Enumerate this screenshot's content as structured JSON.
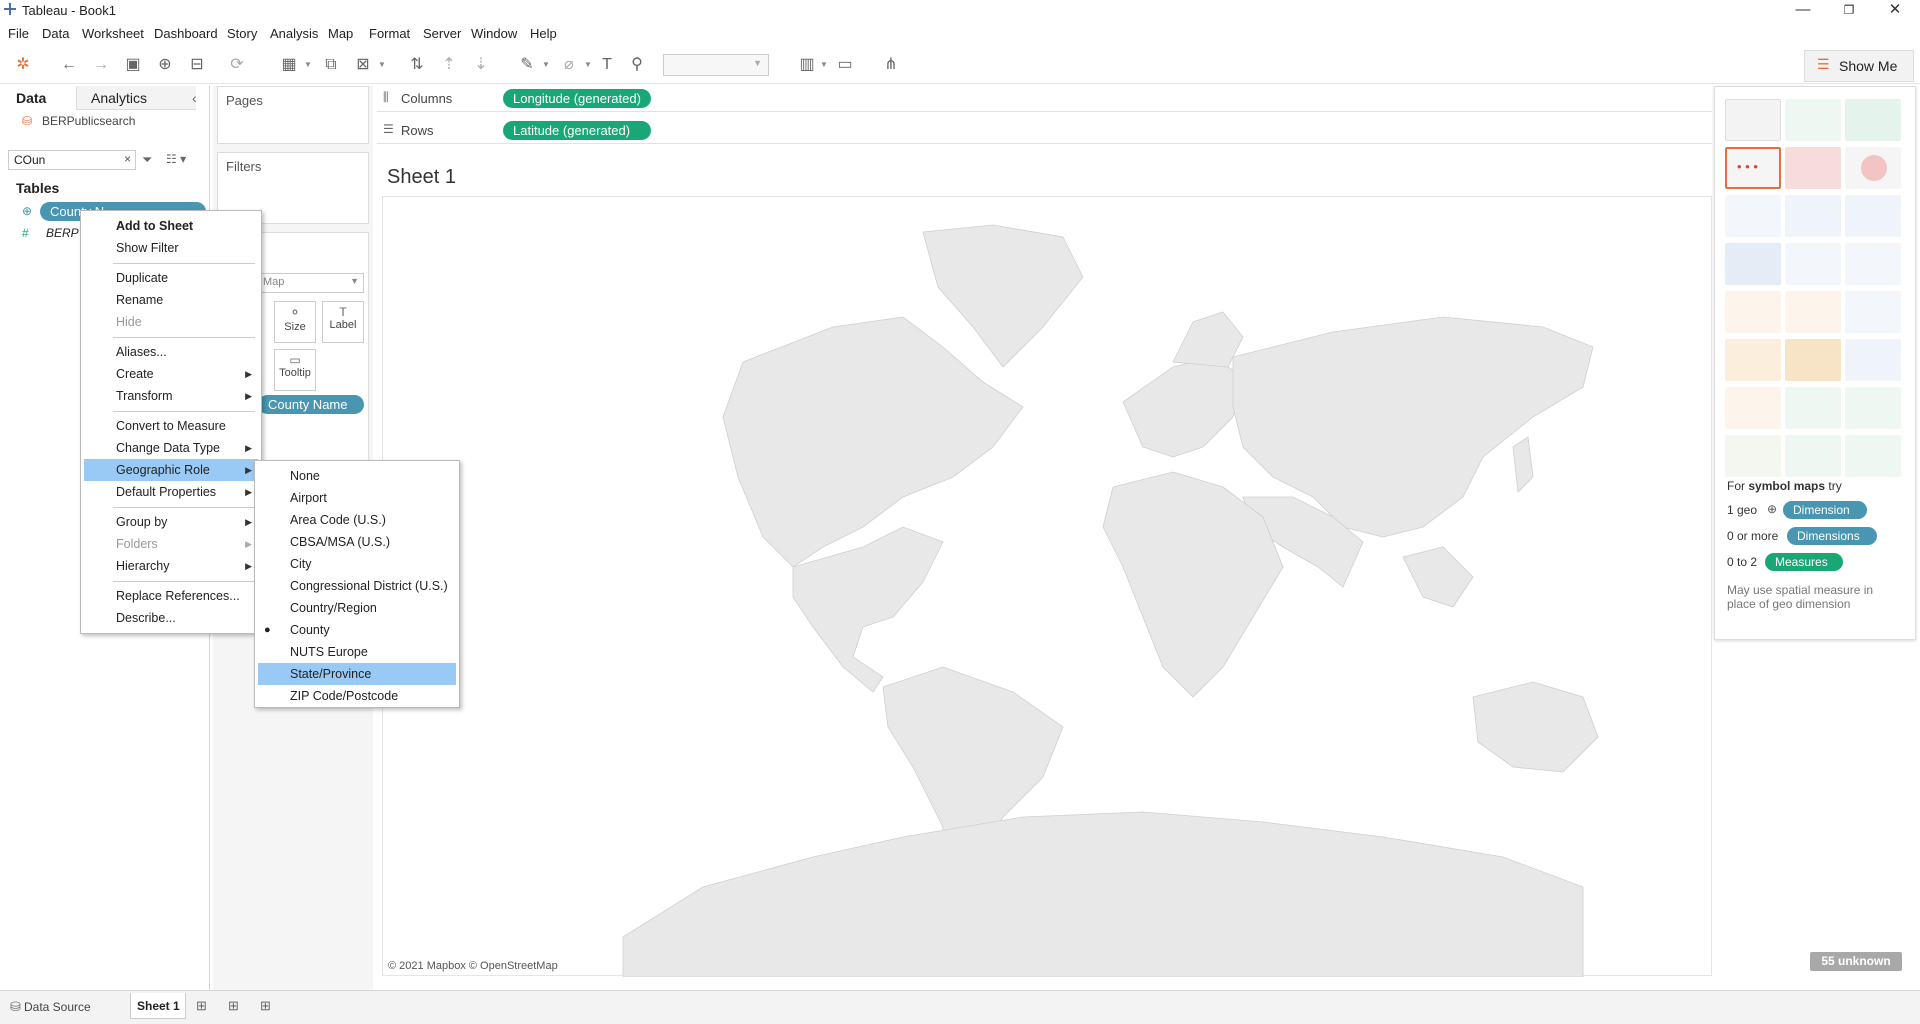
{
  "window": {
    "title": "Tableau - Book1",
    "min": "—",
    "max": "❐",
    "close": "✕"
  },
  "menubar": [
    "File",
    "Data",
    "Worksheet",
    "Dashboard",
    "Story",
    "Analysis",
    "Map",
    "Format",
    "Server",
    "Window",
    "Help"
  ],
  "toolbar": {
    "show_me": "Show Me"
  },
  "left_pane": {
    "tabs": [
      "Data",
      "Analytics"
    ],
    "datasource": "BERPublicsearch",
    "search_value": "COun",
    "tables_heading": "Tables",
    "field_pill": "County N",
    "field_italic": "BERP"
  },
  "cards": {
    "pages": "Pages",
    "filters": "Filters",
    "marks_type": "Map",
    "size": "Size",
    "label": "Label",
    "tooltip": "Tooltip",
    "detail_pill": "County Name"
  },
  "shelves": {
    "columns_label": "Columns",
    "columns_pill": "Longitude (generated)",
    "rows_label": "Rows",
    "rows_pill": "Latitude (generated)"
  },
  "sheet": {
    "title": "Sheet 1",
    "copyright": "© 2021 Mapbox © OpenStreetMap",
    "unknown": "55 unknown"
  },
  "context_menu": {
    "items": [
      "Add to Sheet",
      "Show Filter",
      "Duplicate",
      "Rename",
      "Hide",
      "Aliases...",
      "Create",
      "Transform",
      "Convert to Measure",
      "Change Data Type",
      "Geographic Role",
      "Default Properties",
      "Group by",
      "Folders",
      "Hierarchy",
      "Replace References...",
      "Describe..."
    ]
  },
  "geo_submenu": {
    "items": [
      "None",
      "Airport",
      "Area Code (U.S.)",
      "CBSA/MSA (U.S.)",
      "City",
      "Congressional District (U.S.)",
      "Country/Region",
      "County",
      "NUTS Europe",
      "State/Province",
      "ZIP Code/Postcode"
    ],
    "selected": "County",
    "highlighted": "State/Province"
  },
  "show_me_panel": {
    "hint_prefix": "For",
    "hint_bold": "symbol maps",
    "hint_suffix": "try",
    "r1_label": "1 geo",
    "r1_pill": "Dimension",
    "r2_label": "0 or more",
    "r2_pill": "Dimensions",
    "r3_label": "0 to 2",
    "r3_pill": "Measures",
    "note": "May use spatial measure in place of geo dimension"
  },
  "bottom_tabs": {
    "data_source": "Data Source",
    "sheet": "Sheet 1"
  },
  "colors": {
    "green_pill": "#1aa776",
    "blue_pill": "#4996b2",
    "menu_highlight": "#99c9f5",
    "selected_thumb": "#e5703a"
  }
}
